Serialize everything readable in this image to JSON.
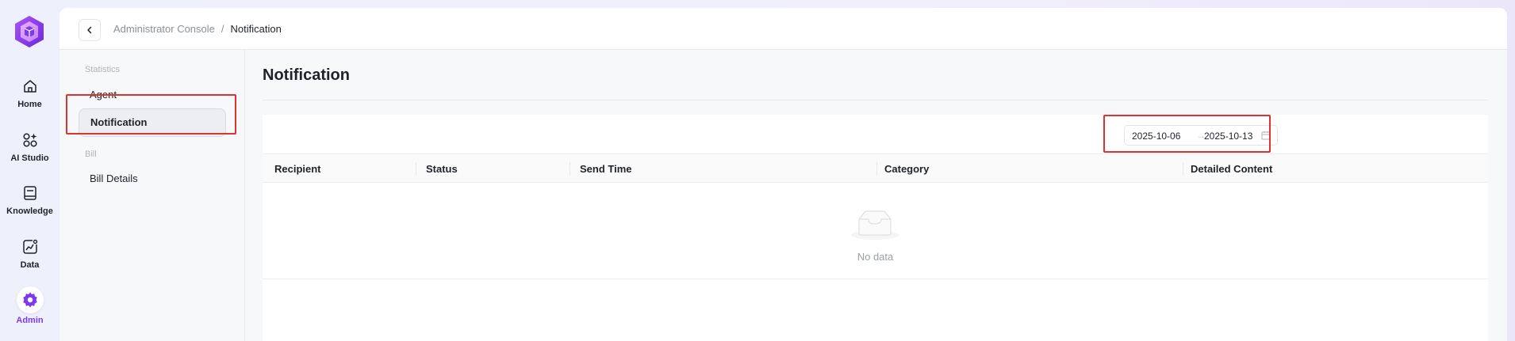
{
  "rail": {
    "items": [
      {
        "label": "Home",
        "icon": "home-icon"
      },
      {
        "label": "AI Studio",
        "icon": "ai-studio-icon"
      },
      {
        "label": "Knowledge",
        "icon": "book-icon"
      },
      {
        "label": "Data",
        "icon": "chart-icon"
      },
      {
        "label": "Admin",
        "icon": "gear-icon"
      }
    ],
    "active": "Admin",
    "accent": "#7c3aed"
  },
  "breadcrumb": {
    "parent": "Administrator Console",
    "separator": "/",
    "current": "Notification"
  },
  "subnav": {
    "sections": [
      {
        "title": "Statistics",
        "items": [
          "Agent",
          "Notification"
        ]
      },
      {
        "title": "Bill",
        "items": [
          "Bill Details"
        ]
      }
    ],
    "active": "Notification"
  },
  "main": {
    "title": "Notification",
    "date_range": {
      "start": "2025-10-06",
      "separator": "→",
      "end": "2025-10-13"
    },
    "table": {
      "columns": [
        "Recipient",
        "Status",
        "Send Time",
        "Category",
        "Detailed Content"
      ],
      "rows": [],
      "empty_text": "No data"
    }
  },
  "annotation_color": "#e03131"
}
